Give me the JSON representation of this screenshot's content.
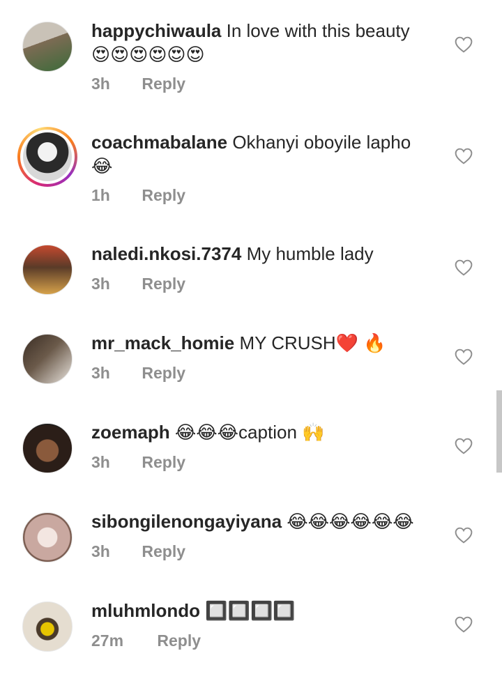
{
  "comments": [
    {
      "username": "happychiwaula",
      "text": "In love with this beauty",
      "emoji_line": "😍😍😍😍😍😍",
      "time": "3h",
      "reply": "Reply",
      "has_story": false,
      "avatar_colors": [
        "#7d6b54",
        "#3c6b3a",
        "#c9c2b7"
      ]
    },
    {
      "username": "coachmabalane",
      "text": "Okhanyi oboyile lapho",
      "emoji_line": "😂",
      "time": "1h",
      "reply": "Reply",
      "has_story": true,
      "avatar_colors": [
        "#d8d8d8",
        "#2a2a2a",
        "#f2f2f2"
      ]
    },
    {
      "username": "naledi.nkosi.7374",
      "text": "My humble lady",
      "emoji_line": "",
      "time": "3h",
      "reply": "Reply",
      "has_story": false,
      "avatar_colors": [
        "#c4492f",
        "#d6a24a",
        "#5a3b28"
      ]
    },
    {
      "username": "mr_mack_homie",
      "text": "MY CRUSH❤️ 🔥",
      "emoji_line": "",
      "time": "3h",
      "reply": "Reply",
      "has_story": false,
      "avatar_colors": [
        "#6b5a4a",
        "#e9e4de",
        "#3a2d24"
      ]
    },
    {
      "username": "zoemaph",
      "text": "😂😂😂caption 🙌",
      "emoji_line": "",
      "time": "3h",
      "reply": "Reply",
      "has_story": false,
      "avatar_colors": [
        "#2b1e18",
        "#8a5a3c",
        "#1a1a1a"
      ]
    },
    {
      "username": "sibongilenongayiyana",
      "text": "😂😂😂😂😂😂",
      "emoji_line": "",
      "time": "3h",
      "reply": "Reply",
      "has_story": false,
      "avatar_colors": [
        "#c9a8a0",
        "#f3e6e1",
        "#7a5c50"
      ]
    },
    {
      "username": "mluhmlondo",
      "text": "🔲🔲🔲🔲",
      "emoji_line": "",
      "time": "27m",
      "reply": "Reply",
      "has_story": false,
      "avatar_colors": [
        "#e5ddd0",
        "#e6c400",
        "#4a3a2a"
      ]
    }
  ],
  "colors": {
    "text": "#262626",
    "meta": "#8e8e8e",
    "heart_outline": "#8e8e8e"
  },
  "icons": {
    "like": "heart-outline-icon"
  }
}
